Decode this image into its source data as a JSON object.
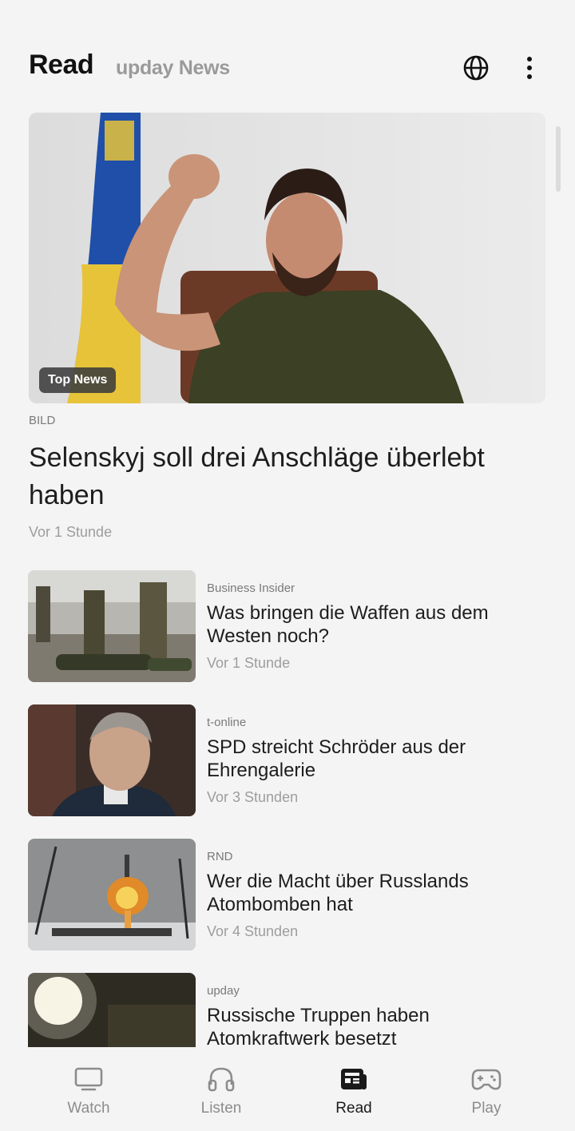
{
  "header": {
    "title": "Read",
    "subtitle": "upday News"
  },
  "hero": {
    "badge": "Top News",
    "source": "BILD",
    "title": "Selenskyj soll drei Anschläge überlebt haben",
    "time": "Vor 1 Stunde"
  },
  "articles": [
    {
      "source": "Business Insider",
      "title": "Was bringen die Waffen aus dem Westen noch?",
      "time": "Vor 1 Stunde"
    },
    {
      "source": "t-online",
      "title": "SPD streicht Schröder aus der Ehrengalerie",
      "time": "Vor 3 Stunden"
    },
    {
      "source": "RND",
      "title": "Wer die Macht über Russlands Atombomben hat",
      "time": "Vor 4 Stunden"
    },
    {
      "source": "upday",
      "title": "Russische Truppen haben Atomkraftwerk besetzt",
      "time": ""
    }
  ],
  "nav": {
    "items": [
      {
        "label": "Watch",
        "icon": "tv-icon"
      },
      {
        "label": "Listen",
        "icon": "headphones-icon"
      },
      {
        "label": "Read",
        "icon": "newspaper-icon"
      },
      {
        "label": "Play",
        "icon": "gamepad-icon"
      }
    ],
    "active": "Read"
  },
  "colors": {
    "background": "#f4f4f4",
    "text": "#1d1d1d",
    "muted": "#9d9d9d",
    "badge": "#3c3c3c"
  }
}
